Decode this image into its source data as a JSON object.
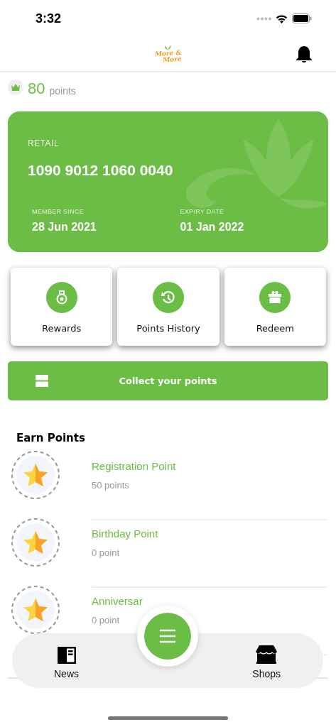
{
  "status_bar": {
    "time": "3:32"
  },
  "header": {
    "logo": [
      "More &",
      "More"
    ]
  },
  "points": {
    "value": "80",
    "unit": "points"
  },
  "card": {
    "tier": "RETAIL",
    "number": "1090 9012 1060 0040",
    "member_since_label": "MEMBER SINCE",
    "member_since": "28 Jun 2021",
    "expiry_label": "EXPIRY DATE",
    "expiry": "01 Jan 2022"
  },
  "actions": [
    {
      "kind": "medal",
      "label": "Rewards"
    },
    {
      "kind": "history",
      "label": "Points History"
    },
    {
      "kind": "gift",
      "label": "Redeem"
    }
  ],
  "collect_button": {
    "label": "Collect your points"
  },
  "earn_points": {
    "title": "Earn Points",
    "items": [
      {
        "name": "Registration Point",
        "points": "50 points"
      },
      {
        "name": "Birthday Point",
        "points": "0 point"
      },
      {
        "name": "Anniversar",
        "points": "0 point"
      }
    ]
  },
  "bottom_nav": [
    {
      "kind": "news",
      "label": "News"
    },
    {
      "kind": "shops",
      "label": "Shops"
    }
  ]
}
